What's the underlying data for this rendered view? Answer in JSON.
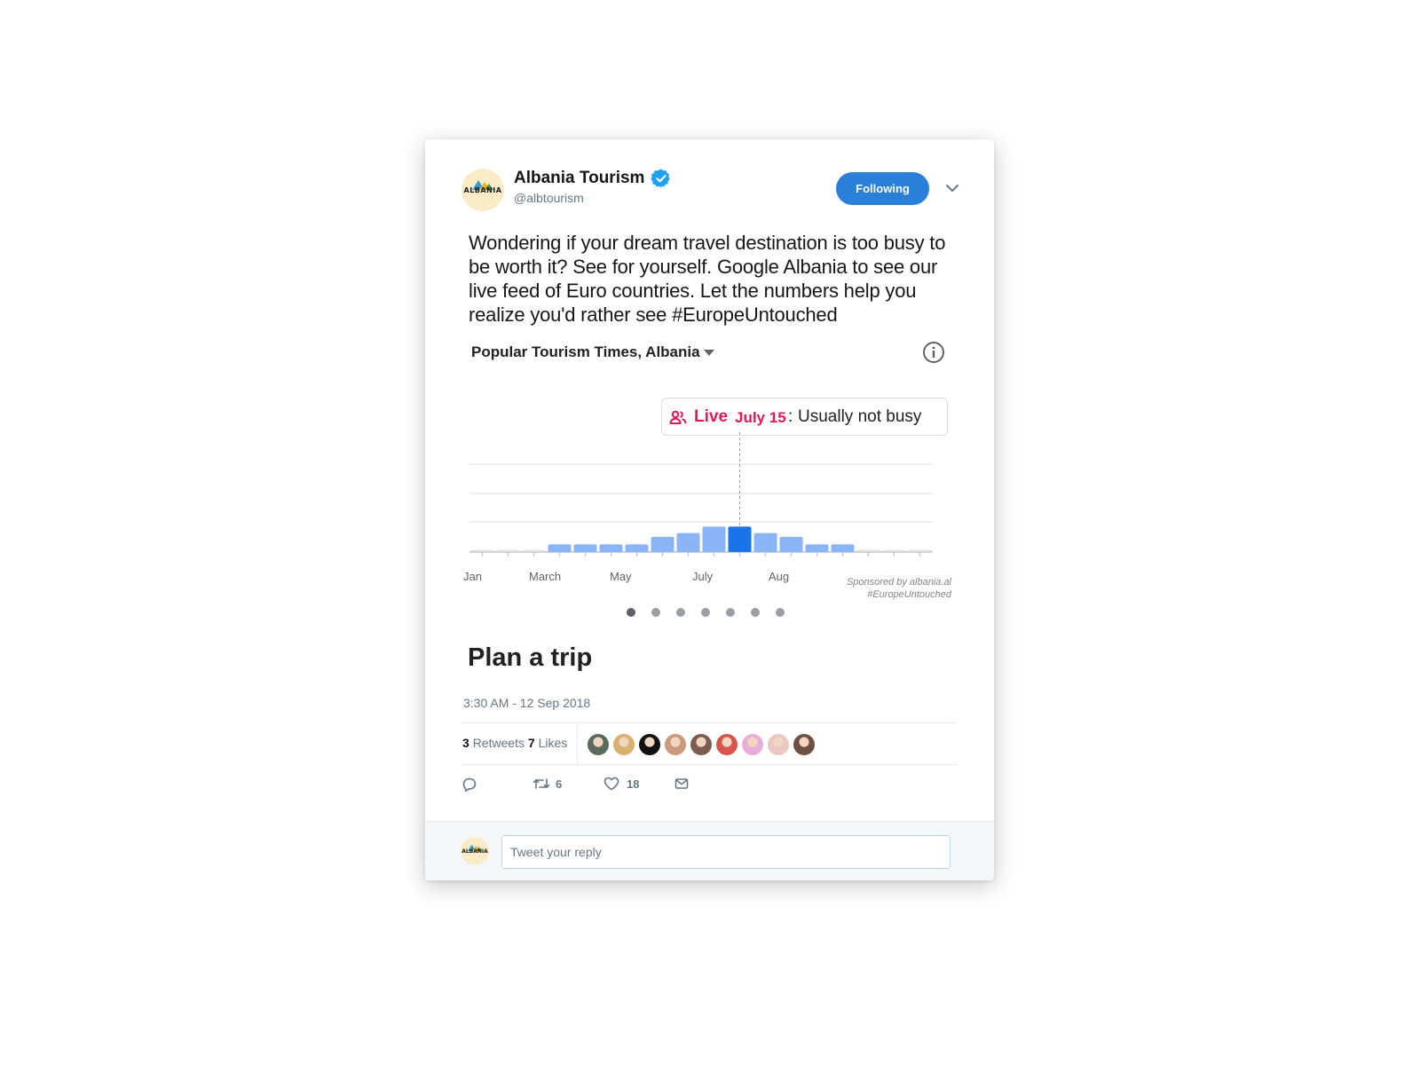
{
  "account": {
    "name": "Albania Tourism",
    "handle": "@albtourism",
    "avatar_logo_text": "ALBANIA",
    "verified_icon": "verified-badge-icon"
  },
  "follow_button": {
    "label": "Following"
  },
  "tweet": {
    "text": "Wondering if your dream travel destination is too busy to be worth it? See for yourself. Google Albania to see our live feed of Euro countries. Let the numbers help you realize you'd rather see #EuropeUntouched",
    "timestamp": "3:30 AM - 12 Sep 2018"
  },
  "embed": {
    "title": "Popular Tourism Times, Albania",
    "live_label": "Live",
    "live_date": "July 15",
    "live_colon": ":",
    "live_status": "Usually not busy",
    "sponsored_line1": "Sponsored by albania.al",
    "sponsored_line2": "#EuropeUntouched",
    "carousel_pages": 7,
    "carousel_active": 1,
    "plan_trip": "Plan a trip"
  },
  "chart_data": {
    "type": "bar",
    "month_labels": [
      "Jan",
      "March",
      "May",
      "July",
      "Aug"
    ],
    "values": [
      0.3,
      0.3,
      0.3,
      1.2,
      1.2,
      1.2,
      1.2,
      2.4,
      3.0,
      4.0,
      4.0,
      3.0,
      2.4,
      1.2,
      1.2,
      0.3,
      0.3,
      0.3
    ],
    "highlight_index": 10,
    "ylim": [
      0,
      14
    ],
    "grid": true,
    "colors": {
      "bar": "#8ab4f8",
      "highlight": "#1a73e8",
      "grid": "#e8eaed"
    }
  },
  "stats": {
    "retweets_count": "3",
    "retweets_label": "Retweets",
    "likes_count": "7",
    "likes_label": "Likes",
    "liker_colors": [
      "#5b6a5e",
      "#d8b070",
      "#111111",
      "#c99a7d",
      "#7a5d50",
      "#d9534f",
      "#e8b0d8",
      "#e9c8c0",
      "#6e5044"
    ]
  },
  "actions": {
    "reply_count": "",
    "retweet_count": "6",
    "like_count": "18"
  },
  "reply": {
    "placeholder": "Tweet your reply"
  }
}
